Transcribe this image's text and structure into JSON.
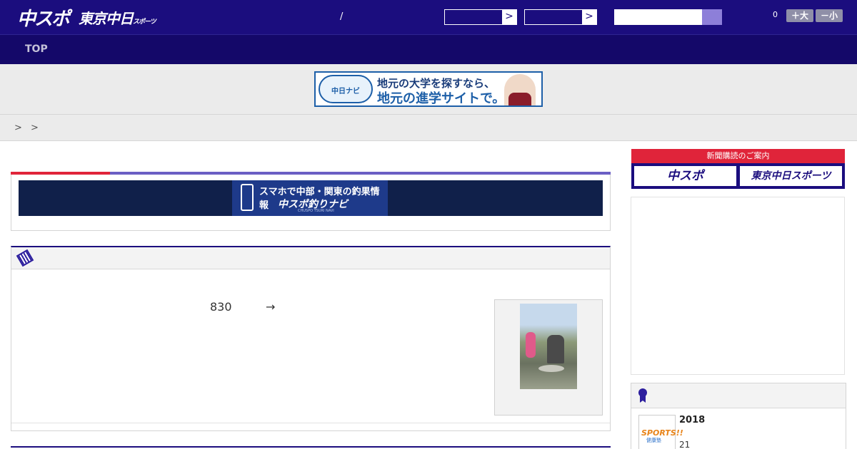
{
  "header": {
    "logo_chuspo": "中スポ",
    "logo_tokyo": "東京中日",
    "logo_tokyo_suffix": "スポーツ",
    "separator": "/",
    "select_arrow": ">",
    "notification_count": "0",
    "font_larger": "＋大",
    "font_smaller": "－小"
  },
  "nav": {
    "top": "TOP"
  },
  "ad_banner": {
    "badge": "中日ナビ",
    "line1": "地元の大学を探すなら、",
    "line2": "地元の進学サイトで。"
  },
  "breadcrumb": "> >",
  "turi_banner": {
    "line1": "スマホで中部・関東の釣果情報",
    "line2": "中スポ釣りナビ",
    "line3": "CHUSPO TSURI NAVI"
  },
  "news": {
    "number": "830",
    "arrow": "→"
  },
  "subscription": {
    "header": "新聞購読のご案内",
    "chuspo": "中スポ",
    "tokyo": "東京中日スポーツ"
  },
  "panel": {
    "thumb_title": "SPORTS!!",
    "thumb_sub": "健康塾",
    "year": "2018",
    "day": "21"
  },
  "colors": {
    "header_bg": "#1b0d7e",
    "nav_bg": "#140869",
    "accent_red": "#e0243a",
    "accent_purple": "#6b5fc4"
  }
}
